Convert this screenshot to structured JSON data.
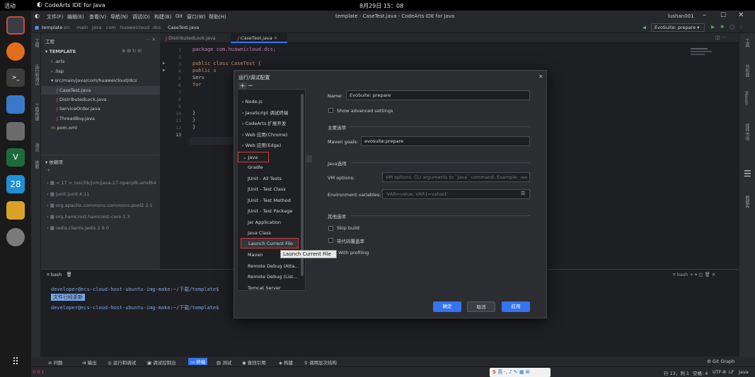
{
  "system_bar": {
    "activities": "活动",
    "app_name": "CodeArts IDE for Java",
    "datetime": "8月29日 15：08"
  },
  "menu": {
    "items": [
      "文件(F)",
      "编辑(E)",
      "查看(V)",
      "导航(N)",
      "调试(D)",
      "构建(B)",
      "Git",
      "窗口(W)",
      "帮助(H)"
    ],
    "window_title": "template - CaseTest.java - CodeArts IDE for Java",
    "user": "lushan001"
  },
  "breadcrumb": {
    "parts": [
      "template",
      "src",
      "main",
      "java",
      "com",
      "huaweicloud",
      "dcs",
      "CaseTest.java"
    ],
    "run_config": "EvoSuite: prepare"
  },
  "left_strip": {
    "labels": [
      "工程",
      "运行和调试",
      "工程构建",
      "测试",
      "依赖"
    ]
  },
  "right_strip": {
    "labels": [
      "工具",
      "分析器",
      "Maven",
      "插件市场",
      "数据库"
    ]
  },
  "project": {
    "title": "工程",
    "root": "TEMPLATE",
    "items": [
      ".arts",
      ".lisp",
      "src/main/java/com/huaweicloud/dcs",
      "CaseTest.java",
      "DistributedLock.java",
      "ServiceOrder.java",
      "ThreadBuy.java",
      "pom.xml"
    ],
    "deps_title": "依赖项",
    "deps": [
      "< 17 > /usr/lib/jvm/java-17-openjdk-amd64",
      "junit:junit 4.11",
      "org.apache.commons:commons-pool2 2.1",
      "org.hamcrest:hamcrest-core 1.3",
      "redis.clients:jedis 2.9.0"
    ]
  },
  "editor_tabs": [
    {
      "label": "DistributedLock.java",
      "active": false
    },
    {
      "label": "CaseTest.java",
      "active": true
    }
  ],
  "code": {
    "line_numbers": [
      "1",
      "2",
      "3",
      "4",
      "5",
      "6",
      "7",
      "8",
      "9",
      "10",
      "11",
      "12",
      "13"
    ],
    "lines": [
      "package com.huaweicloud.dcs;",
      "",
      "public class CaseTest {",
      "    public s",
      "        Serv",
      "        for",
      "",
      "",
      "",
      "      }",
      "    }",
      "}",
      ""
    ]
  },
  "dialog": {
    "title": "运行/调试配置",
    "add": "+",
    "remove": "−",
    "list": [
      "Node.js",
      "JavaScript 调试终端",
      "CodeArts 扩展开发",
      "Web 应用(Chrome)",
      "Web 应用(Edge)",
      "Java",
      "Gradle",
      "JUnit - All Tests",
      "JUnit - Test Class",
      "JUnit - Test Method",
      "JUnit - Test Package",
      "Jar Application",
      "Java Class",
      "Launch Current File",
      "Maven",
      "Remote Debug (Atta...",
      "Remote Debug (List...",
      "Tomcat Server"
    ],
    "tooltip": "Launch Current File",
    "name_label": "Name:",
    "name_value": "EvoSuite: prepare",
    "advanced": "Show advanced settings",
    "section_main": "主要选项",
    "goals_label": "Maven goals:",
    "goals_value": "evosuite:prepare",
    "section_java": "Java选项",
    "vm_label": "VM options:",
    "vm_placeholder": "VM options. CLI arguments to `Java` command. Example: -ea",
    "env_label": "Environment variables:",
    "env_placeholder": "'VAR=value; VAR1=value1'",
    "section_other": "其他选项",
    "skip_build": "Skip build",
    "with_coverage": "带代码覆盖率",
    "with_profiling": "With profiling",
    "ok": "确定",
    "cancel": "取消",
    "apply": "应用"
  },
  "terminal": {
    "tab": "bash",
    "line1": "developer@ecs-cloud-host-ubuntu-img-make:~/下载/template$",
    "line2": "文件已经更新",
    "line3": "developer@ecs-cloud-host-ubuntu-img-make:~/下载/template$",
    "right_tab": "bash"
  },
  "toolwindows": [
    "问题",
    "输出",
    "运行和调试",
    "调试控制台",
    "终端",
    "测试",
    "查找引用",
    "构建",
    "调用层次结构"
  ],
  "status": {
    "left": "0 0 1",
    "position": "行 13，列 1",
    "spaces": "空格: 4",
    "encoding": "UTF-8",
    "eol": "LF",
    "lang": "Java",
    "git": "Git Graph",
    "ime": "英"
  },
  "dock": {
    "badge": "28"
  }
}
